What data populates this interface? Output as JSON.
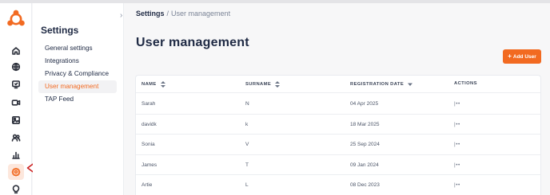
{
  "app": {
    "brand_color": "#f26a21",
    "active_bg": "#fde7dc"
  },
  "rail": {
    "items": [
      {
        "name": "home-icon"
      },
      {
        "name": "globe-icon"
      },
      {
        "name": "monitor-icon"
      },
      {
        "name": "video-icon"
      },
      {
        "name": "image-icon"
      },
      {
        "name": "users-icon"
      },
      {
        "name": "chart-icon"
      },
      {
        "name": "gear-icon",
        "active": true
      },
      {
        "name": "lightbulb-icon"
      }
    ],
    "annotation_arrow_color": "#cc1f1f"
  },
  "settings_panel": {
    "title": "Settings",
    "items": [
      {
        "label": "General settings",
        "active": false
      },
      {
        "label": "Integrations",
        "active": false
      },
      {
        "label": "Privacy & Compliance",
        "active": false
      },
      {
        "label": "User management",
        "active": true
      },
      {
        "label": "TAP Feed",
        "active": false
      }
    ]
  },
  "breadcrumb": {
    "root": "Settings",
    "separator": "/",
    "current": "User management"
  },
  "page": {
    "title": "User management",
    "add_button_label": "Add User"
  },
  "table": {
    "columns": [
      {
        "label": "NAME",
        "sort": "both"
      },
      {
        "label": "SURNAME",
        "sort": "both"
      },
      {
        "label": "REGISTRATION DATE",
        "sort": "desc"
      },
      {
        "label": "ACTIONS",
        "sort": "none"
      }
    ],
    "rows": [
      {
        "name": "Sarah",
        "surname": "N",
        "date": "04 Apr 2025",
        "actions": "|••"
      },
      {
        "name": "davidk",
        "surname": "k",
        "date": "18 Mar 2025",
        "actions": "|••"
      },
      {
        "name": "Sonia",
        "surname": "V",
        "date": "25 Sep 2024",
        "actions": "|••"
      },
      {
        "name": "James",
        "surname": "T",
        "date": "09 Jan 2024",
        "actions": "|••"
      },
      {
        "name": "Artie",
        "surname": "L",
        "date": "08 Dec 2023",
        "actions": "|••"
      }
    ]
  }
}
